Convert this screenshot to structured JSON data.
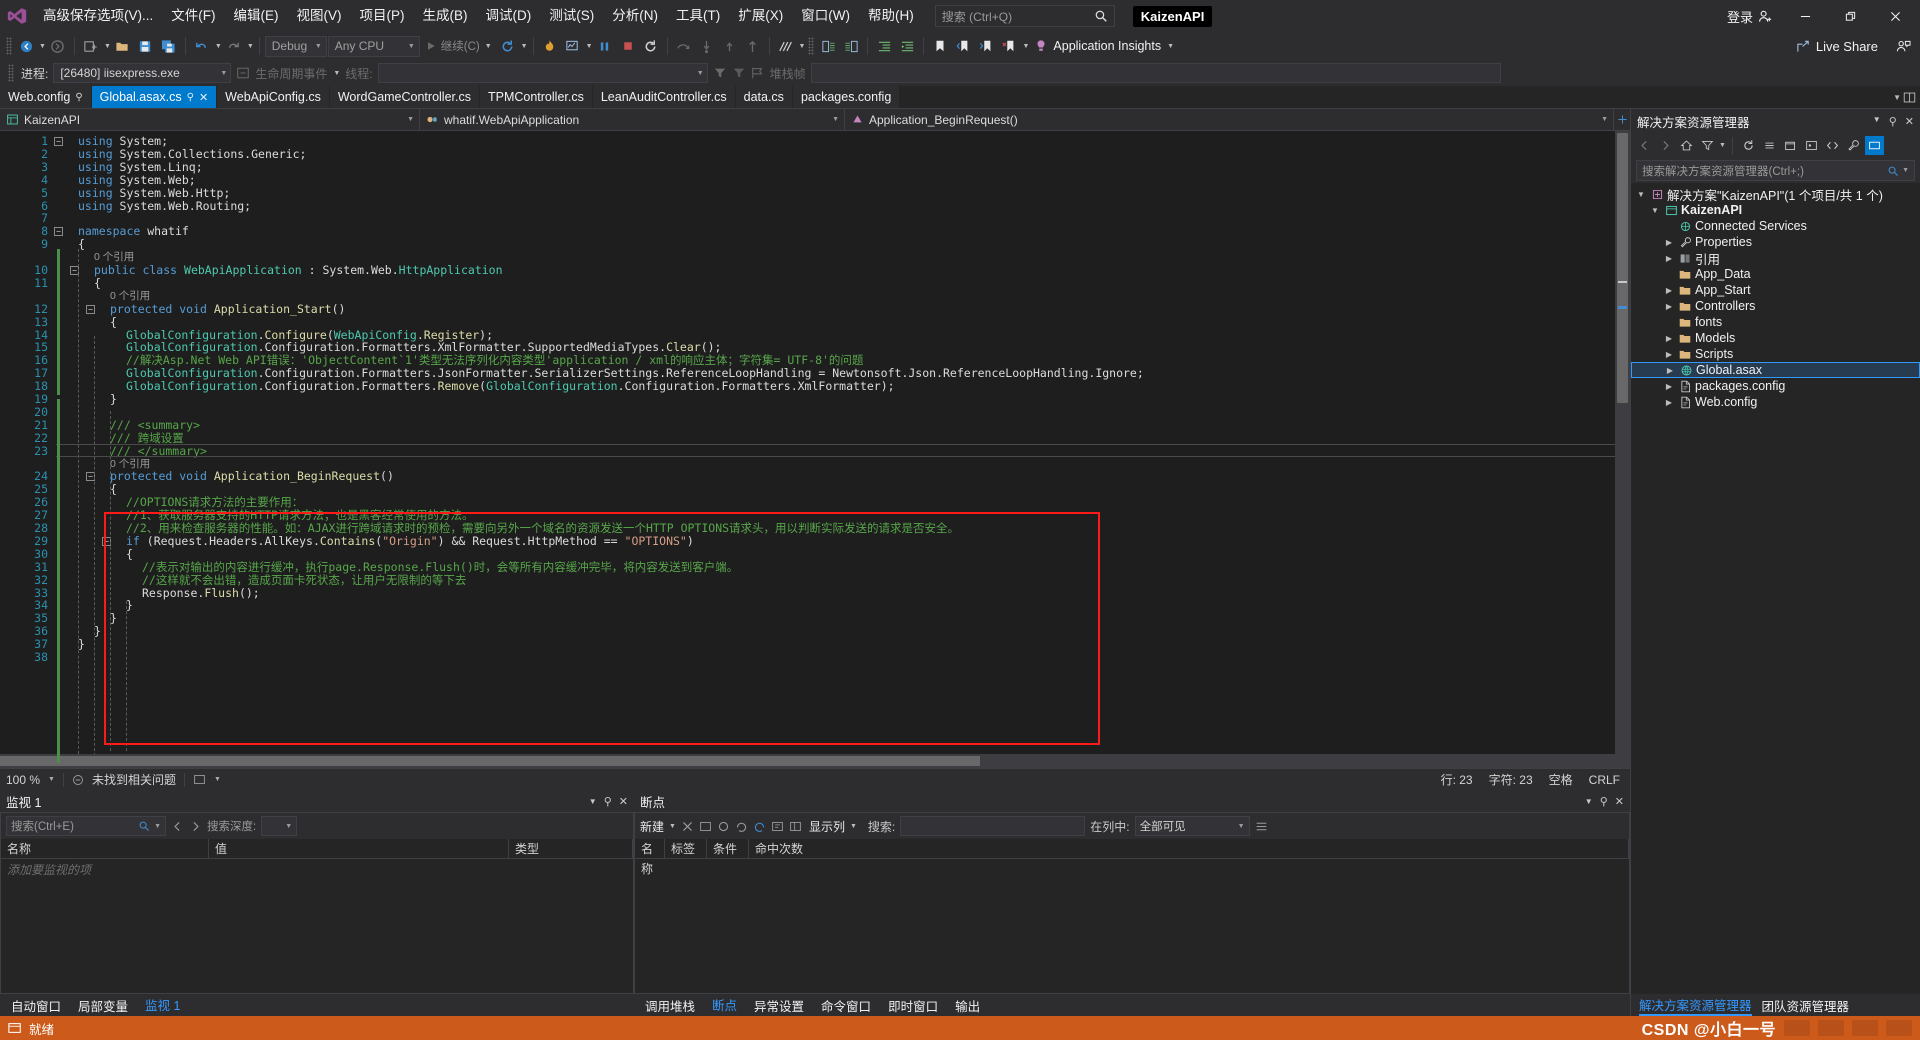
{
  "app": {
    "project_chip": "KaizenAPI",
    "signin_label": "登录"
  },
  "menu": {
    "items": [
      {
        "label": "高级保存选项(V)..."
      },
      {
        "label": "文件(F)"
      },
      {
        "label": "编辑(E)"
      },
      {
        "label": "视图(V)"
      },
      {
        "label": "项目(P)"
      },
      {
        "label": "生成(B)"
      },
      {
        "label": "调试(D)"
      },
      {
        "label": "测试(S)"
      },
      {
        "label": "分析(N)"
      },
      {
        "label": "工具(T)"
      },
      {
        "label": "扩展(X)"
      },
      {
        "label": "窗口(W)"
      },
      {
        "label": "帮助(H)"
      }
    ],
    "quick_search_placeholder": "搜索 (Ctrl+Q)"
  },
  "window_controls": {
    "minimize": "—",
    "maximize": "❐",
    "close": "✕",
    "live_share": "Live Share"
  },
  "toolbar": {
    "config_combo": "Debug",
    "platform_combo": "Any CPU",
    "continue_label": "继续(C)",
    "app_insights": "Application Insights"
  },
  "debugbar": {
    "process_label": "进程:",
    "process_value": "[26480] iisexpress.exe",
    "lifecycle_label": "生命周期事件",
    "thread_label": "线程:",
    "thread_value": "",
    "stack_label": "堆栈帧",
    "stack_value": ""
  },
  "tabs": [
    {
      "label": "Web.config",
      "active": false,
      "pinned": true,
      "closable": false
    },
    {
      "label": "Global.asax.cs",
      "active": true,
      "pinned": true,
      "closable": true
    },
    {
      "label": "WebApiConfig.cs",
      "active": false,
      "pinned": false,
      "closable": false
    },
    {
      "label": "WordGameController.cs",
      "active": false,
      "pinned": false,
      "closable": false
    },
    {
      "label": "TPMController.cs",
      "active": false,
      "pinned": false,
      "closable": false
    },
    {
      "label": "LeanAuditController.cs",
      "active": false,
      "pinned": false,
      "closable": false
    },
    {
      "label": "data.cs",
      "active": false,
      "pinned": false,
      "closable": false
    },
    {
      "label": "packages.config",
      "active": false,
      "pinned": false,
      "closable": false
    }
  ],
  "navbar": {
    "project": "KaizenAPI",
    "type": "whatif.WebApiApplication",
    "member": "Application_BeginRequest()"
  },
  "code": {
    "lines": [
      {
        "n": 1,
        "indent": 0,
        "fold": "minus",
        "tokens": [
          [
            "k",
            "using "
          ],
          [
            "id",
            "System;"
          ]
        ]
      },
      {
        "n": 2,
        "indent": 0,
        "tokens": [
          [
            "k",
            "using "
          ],
          [
            "id",
            "System.Collections.Generic;"
          ]
        ]
      },
      {
        "n": 3,
        "indent": 0,
        "tokens": [
          [
            "k",
            "using "
          ],
          [
            "id",
            "System.Linq;"
          ]
        ]
      },
      {
        "n": 4,
        "indent": 0,
        "tokens": [
          [
            "k",
            "using "
          ],
          [
            "id",
            "System.Web;"
          ]
        ]
      },
      {
        "n": 5,
        "indent": 0,
        "tokens": [
          [
            "k",
            "using "
          ],
          [
            "id",
            "System.Web.Http;"
          ]
        ]
      },
      {
        "n": 6,
        "indent": 0,
        "tokens": [
          [
            "k",
            "using "
          ],
          [
            "id",
            "System.Web.Routing;"
          ]
        ]
      },
      {
        "n": 7,
        "indent": 0,
        "tokens": []
      },
      {
        "n": 8,
        "indent": 0,
        "fold": "minus",
        "tokens": [
          [
            "k",
            "namespace "
          ],
          [
            "id",
            "whatif"
          ]
        ]
      },
      {
        "n": 9,
        "indent": 0,
        "tokens": [
          [
            "id",
            "{"
          ]
        ]
      },
      {
        "n": 10,
        "indent": 1,
        "fold": "minus",
        "ref": "0 个引用",
        "tokens": [
          [
            "k",
            "public class "
          ],
          [
            "ty",
            "WebApiApplication"
          ],
          [
            "id",
            " : "
          ],
          [
            "id",
            "System.Web."
          ],
          [
            "ty",
            "HttpApplication"
          ]
        ]
      },
      {
        "n": 11,
        "indent": 1,
        "tokens": [
          [
            "id",
            "{"
          ]
        ]
      },
      {
        "n": 12,
        "indent": 2,
        "fold": "minus",
        "ref": "0 个引用",
        "tokens": [
          [
            "k",
            "protected void "
          ],
          [
            "mt",
            "Application_Start"
          ],
          [
            "id",
            "()"
          ]
        ]
      },
      {
        "n": 13,
        "indent": 2,
        "tokens": [
          [
            "id",
            "{"
          ]
        ]
      },
      {
        "n": 14,
        "indent": 3,
        "tokens": [
          [
            "ty",
            "GlobalConfiguration"
          ],
          [
            "id",
            "."
          ],
          [
            "mt",
            "Configure"
          ],
          [
            "id",
            "("
          ],
          [
            "ty",
            "WebApiConfig"
          ],
          [
            "id",
            "."
          ],
          [
            "mt",
            "Register"
          ],
          [
            "id",
            ");"
          ]
        ]
      },
      {
        "n": 15,
        "indent": 3,
        "tokens": [
          [
            "ty",
            "GlobalConfiguration"
          ],
          [
            "id",
            ".Configuration.Formatters.XmlFormatter.SupportedMediaTypes."
          ],
          [
            "mt",
            "Clear"
          ],
          [
            "id",
            "();"
          ]
        ]
      },
      {
        "n": 16,
        "indent": 3,
        "tokens": [
          [
            "cm",
            "//解决Asp.Net Web API错误：'ObjectContent`1'类型无法序列化内容类型'application / xml的响应主体；字符集= UTF-8'的问题"
          ]
        ]
      },
      {
        "n": 17,
        "indent": 3,
        "tokens": [
          [
            "ty",
            "GlobalConfiguration"
          ],
          [
            "id",
            ".Configuration.Formatters.JsonFormatter.SerializerSettings.ReferenceLoopHandling = Newtonsoft.Json.ReferenceLoopHandling.Ignore;"
          ]
        ]
      },
      {
        "n": 18,
        "indent": 3,
        "tokens": [
          [
            "ty",
            "GlobalConfiguration"
          ],
          [
            "id",
            ".Configuration.Formatters."
          ],
          [
            "mt",
            "Remove"
          ],
          [
            "id",
            "("
          ],
          [
            "ty",
            "GlobalConfiguration"
          ],
          [
            "id",
            ".Configuration.Formatters.XmlFormatter);"
          ]
        ]
      },
      {
        "n": 19,
        "indent": 2,
        "tokens": [
          [
            "id",
            "}"
          ]
        ]
      },
      {
        "n": 20,
        "indent": 2,
        "tokens": []
      },
      {
        "n": 21,
        "indent": 2,
        "tokens": [
          [
            "xd",
            "/// <summary>"
          ]
        ]
      },
      {
        "n": 22,
        "indent": 2,
        "tokens": [
          [
            "xd",
            "/// 跨域设置"
          ]
        ]
      },
      {
        "n": 23,
        "indent": 2,
        "caret": true,
        "tokens": [
          [
            "xd",
            "/// </summary>"
          ]
        ]
      },
      {
        "n": 24,
        "indent": 2,
        "fold": "minus",
        "ref": "0 个引用",
        "tokens": [
          [
            "k",
            "protected void "
          ],
          [
            "mt",
            "Application_BeginRequest"
          ],
          [
            "id",
            "()"
          ]
        ]
      },
      {
        "n": 25,
        "indent": 2,
        "tokens": [
          [
            "id",
            "{"
          ]
        ]
      },
      {
        "n": 26,
        "indent": 3,
        "tokens": [
          [
            "cm",
            "//OPTIONS请求方法的主要作用："
          ]
        ]
      },
      {
        "n": 27,
        "indent": 3,
        "tokens": [
          [
            "cm",
            "//1、获取服务器支持的HTTP请求方法；也是黑客经常使用的方法。"
          ]
        ]
      },
      {
        "n": 28,
        "indent": 3,
        "tokens": [
          [
            "cm",
            "//2、用来检查服务器的性能。如：AJAX进行跨域请求时的预检，需要向另外一个域名的资源发送一个HTTP OPTIONS请求头，用以判断实际发送的请求是否安全。"
          ]
        ]
      },
      {
        "n": 29,
        "indent": 3,
        "fold": "minus",
        "tokens": [
          [
            "k",
            "if "
          ],
          [
            "id",
            "(Request.Headers.AllKeys."
          ],
          [
            "mt",
            "Contains"
          ],
          [
            "id",
            "("
          ],
          [
            "st",
            "\"Origin\""
          ],
          [
            "id",
            ") && Request.HttpMethod == "
          ],
          [
            "st",
            "\"OPTIONS\""
          ],
          [
            "id",
            ")"
          ]
        ]
      },
      {
        "n": 30,
        "indent": 3,
        "tokens": [
          [
            "id",
            "{"
          ]
        ]
      },
      {
        "n": 31,
        "indent": 4,
        "tokens": [
          [
            "cm",
            "//表示对输出的内容进行缓冲，执行page.Response.Flush()时，会等所有内容缓冲完毕，将内容发送到客户端。"
          ]
        ]
      },
      {
        "n": 32,
        "indent": 4,
        "tokens": [
          [
            "cm",
            "//这样就不会出错，造成页面卡死状态，让用户无限制的等下去"
          ]
        ]
      },
      {
        "n": 33,
        "indent": 4,
        "tokens": [
          [
            "id",
            "Response."
          ],
          [
            "mt",
            "Flush"
          ],
          [
            "id",
            "();"
          ]
        ]
      },
      {
        "n": 34,
        "indent": 3,
        "tokens": [
          [
            "id",
            "}"
          ]
        ]
      },
      {
        "n": 35,
        "indent": 2,
        "tokens": [
          [
            "id",
            "}"
          ]
        ]
      },
      {
        "n": 36,
        "indent": 1,
        "tokens": [
          [
            "id",
            "}"
          ]
        ]
      },
      {
        "n": 37,
        "indent": 0,
        "tokens": [
          [
            "id",
            "}"
          ]
        ]
      },
      {
        "n": 38,
        "indent": 0,
        "tokens": []
      }
    ]
  },
  "editor_status": {
    "zoom": "100 %",
    "issues": "未找到相关问题",
    "line_label": "行: 23",
    "col_label": "字符: 23",
    "spaces": "空格",
    "eol": "CRLF"
  },
  "watch_panel": {
    "title": "监视 1",
    "search_placeholder": "搜索(Ctrl+E)",
    "depth_label": "搜索深度:",
    "depth_value": "",
    "columns": [
      "名称",
      "值",
      "类型"
    ],
    "empty_row": "添加要监视的项",
    "tabs": [
      {
        "label": "自动窗口",
        "active": false
      },
      {
        "label": "局部变量",
        "active": false
      },
      {
        "label": "监视 1",
        "active": true
      }
    ]
  },
  "breakpoints_panel": {
    "title": "断点",
    "new_label": "新建",
    "columns_label": "显示列",
    "search_label": "搜索:",
    "search_value": "",
    "incol_label": "在列中:",
    "incol_value": "全部可见",
    "columns": [
      "名称",
      "标签",
      "条件",
      "命中次数"
    ],
    "tabs": [
      {
        "label": "调用堆栈",
        "active": false
      },
      {
        "label": "断点",
        "active": true
      },
      {
        "label": "异常设置",
        "active": false
      },
      {
        "label": "命令窗口",
        "active": false
      },
      {
        "label": "即时窗口",
        "active": false
      },
      {
        "label": "输出",
        "active": false
      }
    ]
  },
  "solution_explorer": {
    "title": "解决方案资源管理器",
    "search_placeholder": "搜索解决方案资源管理器(Ctrl+;)",
    "root": "解决方案\"KaizenAPI\"(1 个项目/共 1 个)",
    "tree": [
      {
        "label": "KaizenAPI",
        "depth": 1,
        "arrow": "down",
        "icon": "project-icon",
        "bold": true,
        "selected": false
      },
      {
        "label": "Connected Services",
        "depth": 2,
        "arrow": "none",
        "icon": "services-icon",
        "selected": false
      },
      {
        "label": "Properties",
        "depth": 2,
        "arrow": "right",
        "icon": "wrench-icon",
        "selected": false
      },
      {
        "label": "引用",
        "depth": 2,
        "arrow": "right",
        "icon": "references-icon",
        "selected": false
      },
      {
        "label": "App_Data",
        "depth": 2,
        "arrow": "none",
        "icon": "folder-icon",
        "selected": false
      },
      {
        "label": "App_Start",
        "depth": 2,
        "arrow": "right",
        "icon": "folder-icon",
        "selected": false
      },
      {
        "label": "Controllers",
        "depth": 2,
        "arrow": "right",
        "icon": "folder-icon",
        "selected": false
      },
      {
        "label": "fonts",
        "depth": 2,
        "arrow": "none",
        "icon": "folder-icon",
        "selected": false
      },
      {
        "label": "Models",
        "depth": 2,
        "arrow": "right",
        "icon": "folder-icon",
        "selected": false
      },
      {
        "label": "Scripts",
        "depth": 2,
        "arrow": "right",
        "icon": "folder-icon",
        "selected": false
      },
      {
        "label": "Global.asax",
        "depth": 2,
        "arrow": "right",
        "icon": "asax-icon",
        "selected": true
      },
      {
        "label": "packages.config",
        "depth": 2,
        "arrow": "right",
        "icon": "config-icon",
        "selected": false
      },
      {
        "label": "Web.config",
        "depth": 2,
        "arrow": "right",
        "icon": "config-icon",
        "selected": false
      }
    ],
    "bottom_tabs": [
      {
        "label": "解决方案资源管理器",
        "active": true
      },
      {
        "label": "团队资源管理器",
        "active": false
      }
    ]
  },
  "statusbar": {
    "state": "就绪",
    "watermark": "CSDN @小白一号"
  },
  "colors": {
    "accent": "#007acc",
    "status_orange": "#cc5a1a",
    "highlight_red": "#ff1a1a",
    "keyword_blue": "#569cd6",
    "type_teal": "#4ec9b0",
    "comment_green": "#57a64a",
    "string_orange": "#d69d85"
  }
}
